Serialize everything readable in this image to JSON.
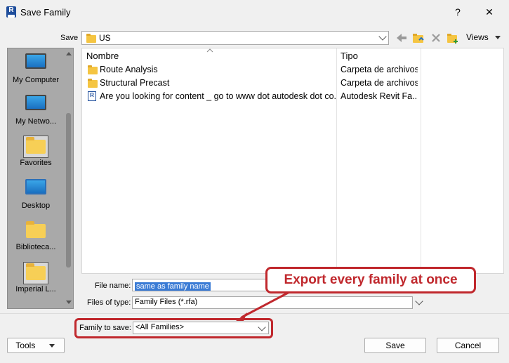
{
  "window": {
    "title": "Save Family",
    "app_icon": "R",
    "help": "?",
    "close": "✕"
  },
  "toolbar": {
    "save_in_label": "Save",
    "location": "US",
    "views_label": "Views"
  },
  "places": [
    {
      "label": "My Computer"
    },
    {
      "label": "My Netwo..."
    },
    {
      "label": "Favorites"
    },
    {
      "label": "Desktop"
    },
    {
      "label": "Biblioteca..."
    },
    {
      "label": "Imperial L..."
    }
  ],
  "list": {
    "columns": [
      "Nombre",
      "Tipo"
    ],
    "rows": [
      {
        "name": "Route Analysis",
        "type": "Carpeta de archivos",
        "icon": "folder-icon"
      },
      {
        "name": "Structural Precast",
        "type": "Carpeta de archivos",
        "icon": "folder-icon"
      },
      {
        "name": "Are you looking for content _ go to www dot autodesk dot co...",
        "type": "Autodesk Revit Fa...",
        "icon": "revit-file-icon"
      }
    ]
  },
  "form": {
    "file_name_label": "File name:",
    "file_name_value": "same as family name",
    "files_of_type_label": "Files of type:",
    "files_of_type_value": "Family Files (*.rfa)",
    "family_to_save_label": "Family to save:",
    "family_to_save_value": "<All Families>"
  },
  "buttons": {
    "tools": "Tools",
    "save": "Save",
    "cancel": "Cancel"
  },
  "annotation": {
    "callout": "Export every family at once"
  },
  "colors": {
    "accent_red": "#c0282d",
    "selection_blue": "#3a7bd5"
  }
}
